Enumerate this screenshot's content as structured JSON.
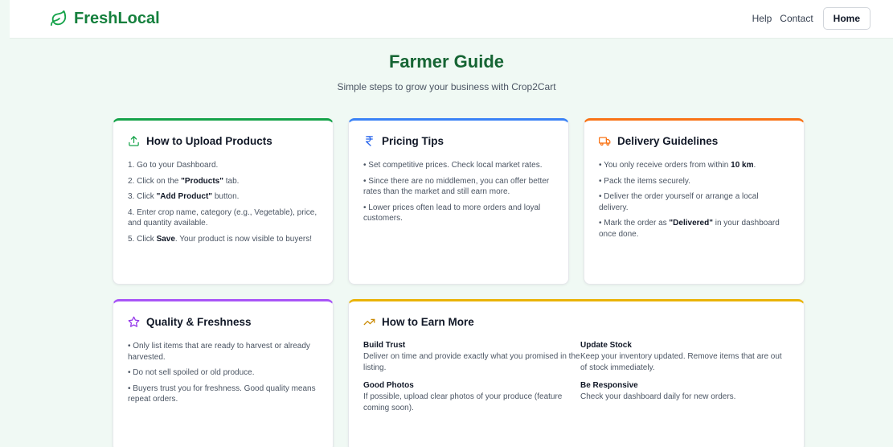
{
  "brand": {
    "name": "FreshLocal",
    "color": "#15803d"
  },
  "nav": {
    "help": "Help",
    "contact": "Contact",
    "home": "Home"
  },
  "hero": {
    "title": "Farmer Guide",
    "subtitle": "Simple steps to grow your business with Crop2Cart"
  },
  "cards": {
    "upload": {
      "title": "How to Upload Products",
      "icon": "upload-icon",
      "accent": "#16a34a",
      "steps": [
        {
          "a": "1. Go to your Dashboard.",
          "b": "",
          "c": ""
        },
        {
          "a": "2. Click on the ",
          "b": "\"Products\"",
          "c": " tab."
        },
        {
          "a": "3. Click ",
          "b": "\"Add Product\"",
          "c": " button."
        },
        {
          "a": "4. Enter crop name, category (e.g., Vegetable), price, and quantity available.",
          "b": "",
          "c": ""
        },
        {
          "a": "5. Click ",
          "b": "Save",
          "c": ". Your product is now visible to buyers!"
        }
      ]
    },
    "pricing": {
      "title": "Pricing Tips",
      "icon": "rupee-icon",
      "accent": "#3b82f6",
      "tips": [
        "• Set competitive prices. Check local market rates.",
        "• Since there are no middlemen, you can offer better rates than the market and still earn more.",
        "• Lower prices often lead to more orders and loyal customers."
      ]
    },
    "delivery": {
      "title": "Delivery Guidelines",
      "icon": "truck-icon",
      "accent": "#f97316",
      "items": [
        {
          "a": "• You only receive orders from within ",
          "b": "10 km",
          "c": "."
        },
        {
          "a": "• Pack the items securely.",
          "b": "",
          "c": ""
        },
        {
          "a": "• Deliver the order yourself or arrange a local delivery.",
          "b": "",
          "c": ""
        },
        {
          "a": "• Mark the order as ",
          "b": "\"Delivered\"",
          "c": " in your dashboard once done."
        }
      ]
    },
    "quality": {
      "title": "Quality & Freshness",
      "icon": "star-icon",
      "accent": "#a855f7",
      "items": [
        "• Only list items that are ready to harvest or already harvested.",
        "• Do not sell spoiled or old produce.",
        "• Buyers trust you for freshness. Good quality means repeat orders."
      ]
    },
    "earn": {
      "title": "How to Earn More",
      "icon": "trending-up-icon",
      "accent": "#eab308",
      "items": [
        {
          "heading": "Build Trust",
          "text": "Deliver on time and provide exactly what you promised in the listing."
        },
        {
          "heading": "Update Stock",
          "text": "Keep your inventory updated. Remove items that are out of stock immediately."
        },
        {
          "heading": "Good Photos",
          "text": "If possible, upload clear photos of your produce (feature coming soon)."
        },
        {
          "heading": "Be Responsive",
          "text": "Check your dashboard daily for new orders."
        }
      ]
    }
  }
}
